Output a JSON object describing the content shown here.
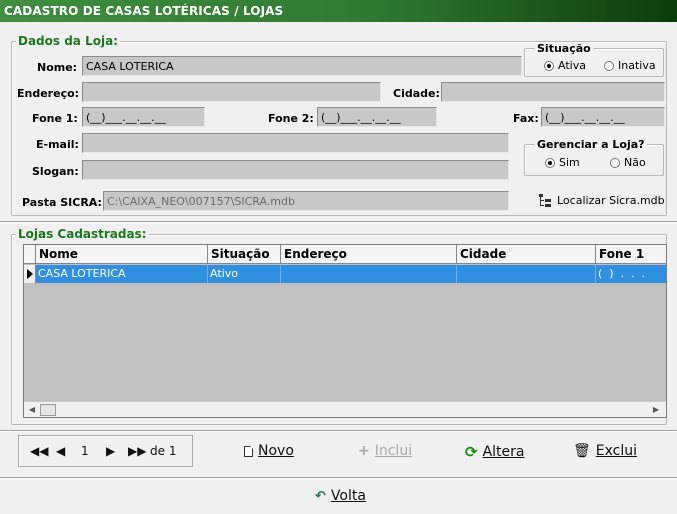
{
  "window": {
    "title": "CADASTRO DE CASAS LOTÉRICAS / LOJAS"
  },
  "store": {
    "legend": "Dados da Loja:",
    "nome_label": "Nome:",
    "nome_value": "CASA LOTERICA",
    "endereco_label": "Endereço:",
    "endereco_value": "",
    "cidade_label": "Cidade:",
    "cidade_value": "",
    "fone1_label": "Fone 1:",
    "fone1_value": "(__)___.__.__.__",
    "fone2_label": "Fone 2:",
    "fone2_value": "(__)___.__.__.__",
    "fax_label": "Fax:",
    "fax_value": "(__)___.__.__.__",
    "email_label": "E-mail:",
    "email_value": "",
    "slogan_label": "Slogan:",
    "slogan_value": "",
    "pasta_label": "Pasta SICRA:",
    "pasta_value": "C:\\CAIXA_NEO\\007157\\SICRA.mdb",
    "localizar_label": "Localizar Sicra.mdb"
  },
  "situacao": {
    "legend": "Situação",
    "options": [
      "Ativa",
      "Inativa"
    ],
    "selected": "Ativa"
  },
  "gerenciar": {
    "legend": "Gerenciar a Loja?",
    "options": [
      "Sim",
      "Não"
    ],
    "selected": "Sim"
  },
  "lojas": {
    "legend": "Lojas Cadastradas:",
    "columns": [
      "Nome",
      "Situação",
      "Endereço",
      "Cidade",
      "Fone 1"
    ],
    "rows": [
      [
        "CASA LOTERICA",
        "Ativo",
        "",
        "",
        "(  )  .  .  ."
      ]
    ]
  },
  "navigator": {
    "page": "1",
    "total": "de 1"
  },
  "actions": {
    "novo": "Novo",
    "inclui": "Inclui",
    "altera": "Altera",
    "exclui": "Exclui",
    "volta": "Volta"
  },
  "colors": {
    "title_green": "#2f7a2f",
    "selection_blue": "#2f8fe0",
    "legend_green": "#1a7a1a"
  }
}
